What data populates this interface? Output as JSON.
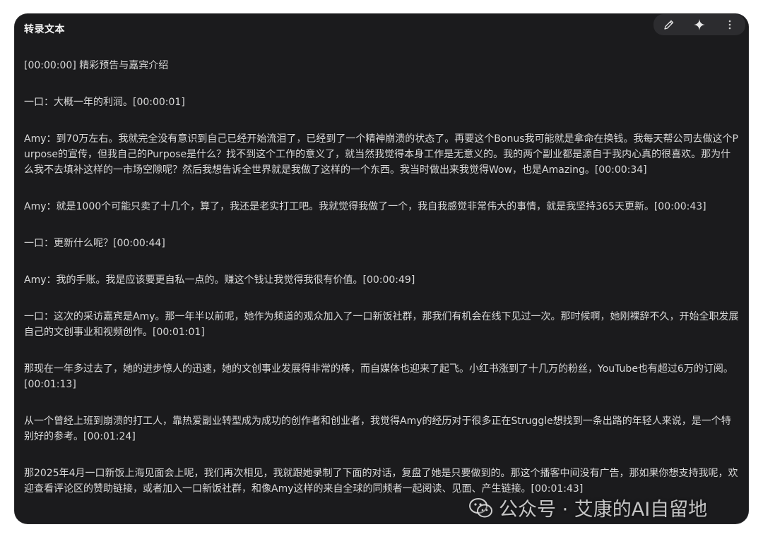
{
  "header": {
    "title": "转录文本"
  },
  "toolbar": {
    "icons": [
      "pencil-icon",
      "sparkle-icon",
      "more-vertical-icon"
    ]
  },
  "transcript": [
    "[00:00:00] 精彩预告与嘉宾介绍",
    "一口：大概一年的利润。[00:00:01]",
    "Amy：到70万左右。我就完全没有意识到自己已经开始流泪了，已经到了一个精神崩溃的状态了。再要这个Bonus我可能就是拿命在换钱。我每天帮公司去做这个Purpose的宣传，但我自己的Purpose是什么？找不到这个工作的意义了，就当然我觉得本身工作是无意义的。我的两个副业都是源自于我内心真的很喜欢。那为什么我不去填补这样的一市场空隙呢？然后我想告诉全世界就是我做了这样的一个东西。我当时做出来我觉得Wow，也是Amazing。[00:00:34]",
    "Amy：就是1000个可能只卖了十几个，算了，我还是老实打工吧。我就觉得我做了一个，我自我感觉非常伟大的事情，就是我坚持365天更新。[00:00:43]",
    "一口：更新什么呢？[00:00:44]",
    "Amy：我的手账。我是应该要更自私一点的。赚这个钱让我觉得我很有价值。[00:00:49]",
    "一口：这次的采访嘉宾是Amy。那一年半以前呢，她作为频道的观众加入了一口新饭社群，那我们有机会在线下见过一次。那时候啊，她刚裸辞不久，开始全职发展自己的文创事业和视频创作。[00:01:01]",
    "那现在一年多过去了，她的进步惊人的迅速，她的文创事业发展得非常的棒，而自媒体也迎来了起飞。小红书涨到了十几万的粉丝，YouTube也有超过6万的订阅。[00:01:13]",
    "从一个曾经上班到崩溃的打工人，靠热爱副业转型成为成功的创作者和创业者，我觉得Amy的经历对于很多正在Struggle想找到一条出路的年轻人来说，是一个特别好的参考。[00:01:24]",
    "那2025年4月一口新饭上海见面会上呢，我们再次相见，我就跟她录制了下面的对话，复盘了她是只要做到的。那这个播客中间没有广告，那如果你想支持我呢，欢迎查看评论区的赞助链接，或者加入一口新饭社群，和像Amy这样的来自全球的同频者一起阅读、见面、产生链接。[00:01:43]"
  ],
  "watermark": {
    "text": "公众号 · 艾康的AI自留地"
  }
}
